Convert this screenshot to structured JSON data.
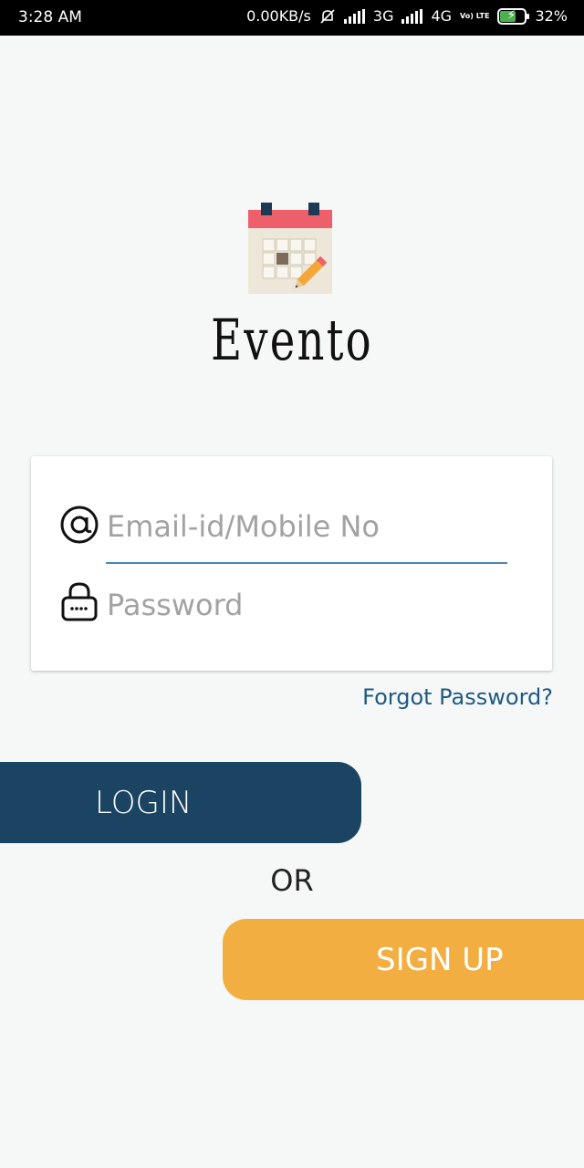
{
  "status_bar": {
    "time": "3:28 AM",
    "data_speed": "0.00KB/s",
    "network_1": "3G",
    "network_2": "4G",
    "volte": "Vo) LTE",
    "battery": "32%"
  },
  "app": {
    "title": "Evento"
  },
  "login_form": {
    "email_placeholder": "Email-id/Mobile No",
    "email_value": "",
    "password_placeholder": "Password",
    "password_value": "",
    "forgot_password": "Forgot Password?"
  },
  "actions": {
    "login_label": "LOGIN",
    "or_label": "OR",
    "signup_label": "SIGN UP"
  },
  "colors": {
    "login_button": "#1a4462",
    "signup_button": "#f3ae41",
    "link": "#1f5a83",
    "underline": "#4a86b8"
  },
  "icons": [
    "calendar-pencil-icon",
    "at-sign-icon",
    "lock-icon",
    "silent-bell-icon",
    "signal-icon",
    "battery-icon"
  ]
}
